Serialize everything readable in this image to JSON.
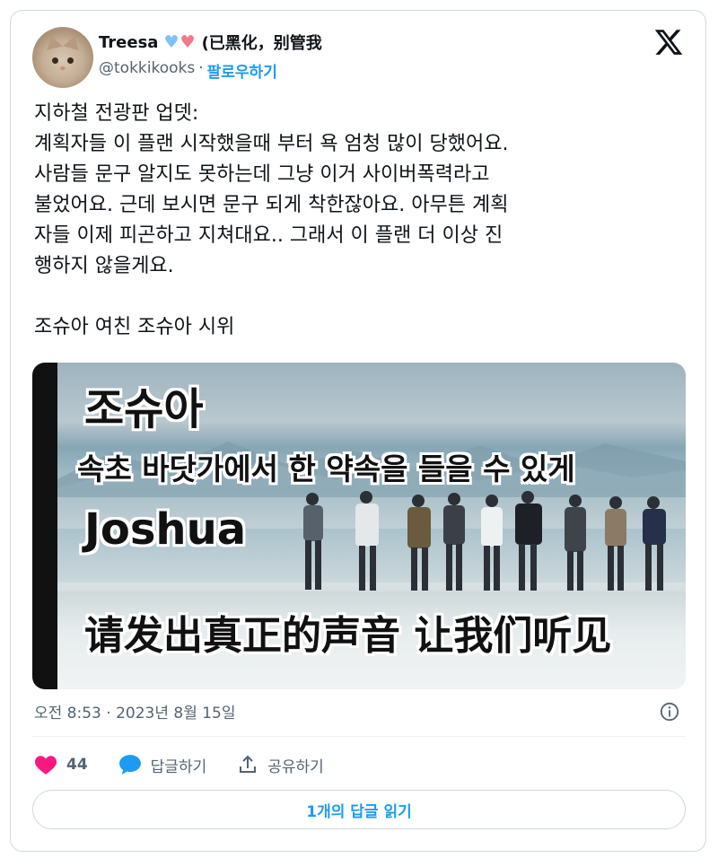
{
  "author": {
    "name": "Treesa",
    "hearts": "💙💗",
    "name_suffix": "(已黑化，别管我",
    "handle": "@tokkikooks",
    "separator": "·",
    "follow_label": "팔로우하기"
  },
  "tweet": {
    "text": "지하철 전광판 업뎃:\n계획자들 이 플랜 시작했을때 부터 욕 엄청 많이 당했어요.\n사람들 문구 알지도 못하는데 그냥 이거 사이버폭력라고\n불었어요. 근데 보시면 문구 되게 착한잖아요. 아무튼 계획\n자들 이제 피곤하고 지쳐대요.. 그래서 이 플랜 더 이상 진\n행하지 않을게요.\n\n조슈아 여친 조슈아 시위",
    "timestamp": "오전 8:53 · 2023년 8월 15일"
  },
  "media": {
    "caption_name_ko": "조슈아",
    "caption_line_ko": "속초 바닷가에서 한 약속을 들을 수 있게",
    "caption_name_en": "Joshua",
    "caption_line_zh": "请发出真正的声音 让我们听见"
  },
  "actions": {
    "like_count": "44",
    "reply_label": "답글하기",
    "share_label": "공유하기",
    "read_replies_label": "1개의 답글 읽기"
  },
  "colors": {
    "accent": "#1d9bf0",
    "like": "#f91880",
    "text_secondary": "#536471"
  },
  "icons": [
    "x-logo-icon",
    "info-icon",
    "heart-icon",
    "reply-bubble-icon",
    "share-icon"
  ]
}
